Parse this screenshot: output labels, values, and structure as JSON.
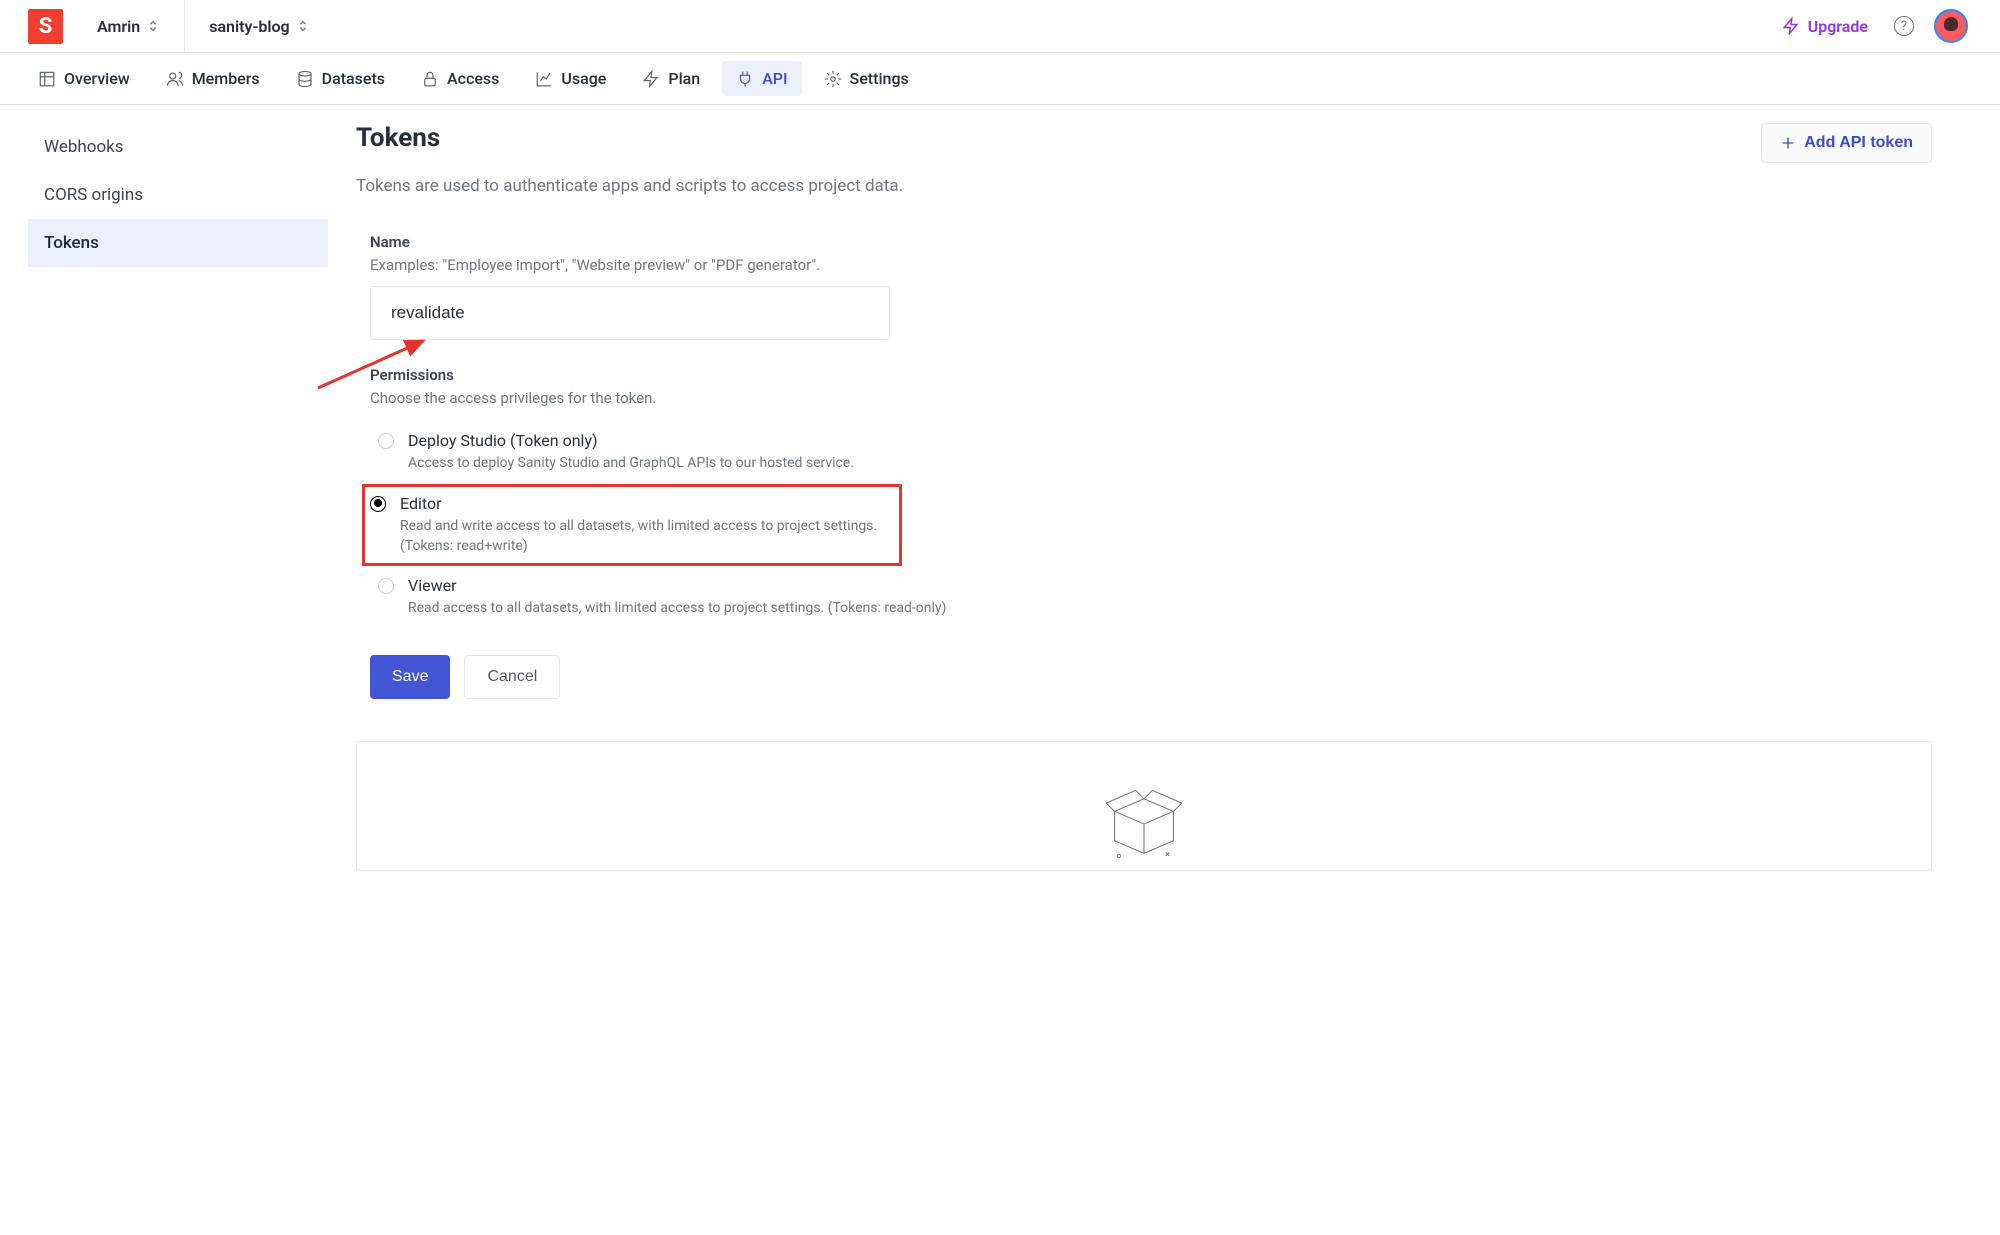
{
  "header": {
    "org": "Amrin",
    "project": "sanity-blog",
    "upgrade": "Upgrade"
  },
  "tabs": {
    "overview": "Overview",
    "members": "Members",
    "datasets": "Datasets",
    "access": "Access",
    "usage": "Usage",
    "plan": "Plan",
    "api": "API",
    "settings": "Settings"
  },
  "sidebar": {
    "webhooks": "Webhooks",
    "cors": "CORS origins",
    "tokens": "Tokens"
  },
  "page": {
    "title": "Tokens",
    "intro": "Tokens are used to authenticate apps and scripts to access project data.",
    "add_btn": "Add API token"
  },
  "form": {
    "name_label": "Name",
    "name_hint": "Examples: \"Employee import\", \"Website preview\" or \"PDF generator\".",
    "name_value": "revalidate",
    "perm_label": "Permissions",
    "perm_hint": "Choose the access privileges for the token.",
    "save": "Save",
    "cancel": "Cancel"
  },
  "permissions": {
    "deploy": {
      "title": "Deploy Studio (Token only)",
      "desc": "Access to deploy Sanity Studio and GraphQL APIs to our hosted service."
    },
    "editor": {
      "title": "Editor",
      "desc": "Read and write access to all datasets, with limited access to project settings. (Tokens: read+write)"
    },
    "viewer": {
      "title": "Viewer",
      "desc": "Read access to all datasets, with limited access to project settings. (Tokens: read-only)"
    }
  }
}
